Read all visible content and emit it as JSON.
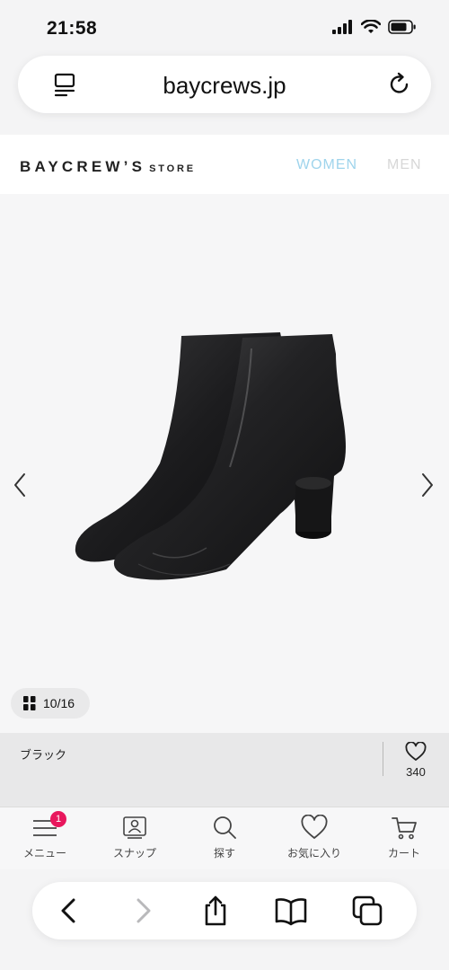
{
  "status_bar": {
    "time": "21:58"
  },
  "browser": {
    "url": "baycrews.jp"
  },
  "site": {
    "logo_main": "BAYCREW’S",
    "logo_sub": "STORE",
    "nav": {
      "women": "WOMEN",
      "men": "MEN"
    }
  },
  "product": {
    "image_counter": "10/16",
    "color_name": "ブラック",
    "favorite_count": "340"
  },
  "tab_bar": {
    "items": [
      {
        "label": "メニュー",
        "icon": "menu-icon",
        "badge": "1"
      },
      {
        "label": "スナップ",
        "icon": "snap-icon"
      },
      {
        "label": "探す",
        "icon": "search-icon"
      },
      {
        "label": "お気に入り",
        "icon": "heart-icon"
      },
      {
        "label": "カート",
        "icon": "cart-icon"
      }
    ]
  },
  "colors": {
    "accent_women": "#9fd4ec",
    "badge": "#e8175d"
  }
}
